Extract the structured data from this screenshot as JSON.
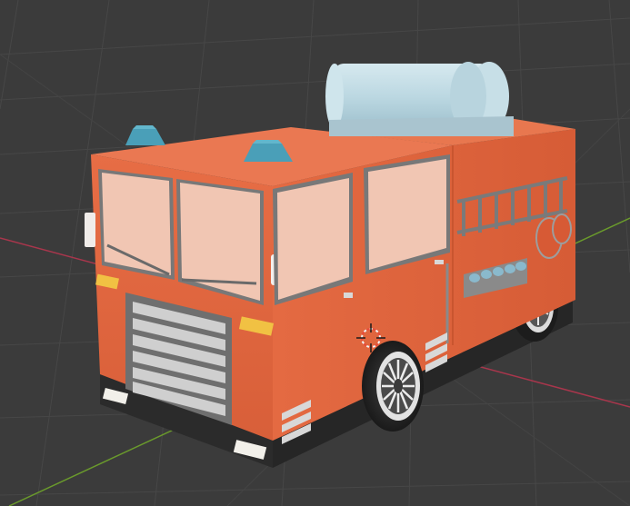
{
  "viewport": {
    "background": "#3b3b3b",
    "grid_color": "#4a4a4a",
    "x_axis_color": "#b0384f",
    "y_axis_color": "#6a9a2c"
  },
  "scene_objects": [
    {
      "id": "fire-truck",
      "body_color": "#e2673f",
      "window_color": "#f1c6b3",
      "light_color": "#4a9fb8",
      "tank_color": "#bcd8e2"
    },
    {
      "id": "3d-cursor"
    }
  ]
}
